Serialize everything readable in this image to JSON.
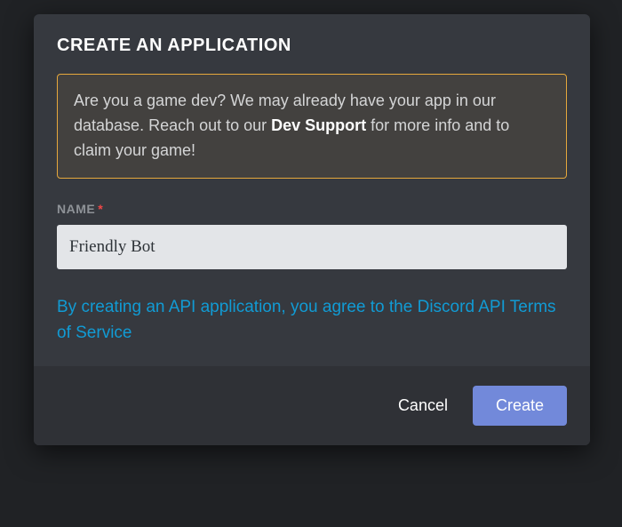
{
  "modal": {
    "title": "CREATE AN APPLICATION",
    "notice": {
      "prefix": "Are you a game dev? We may already have your app in our database. Reach out to our ",
      "strong": "Dev Support",
      "suffix": " for more info and to claim your game!"
    },
    "name": {
      "label": "NAME",
      "required_marker": "*",
      "value": "Friendly Bot"
    },
    "terms": {
      "prefix": "By creating an API application, you agree to the ",
      "link": "Discord API Terms of Service"
    },
    "buttons": {
      "cancel": "Cancel",
      "create": "Create"
    }
  }
}
